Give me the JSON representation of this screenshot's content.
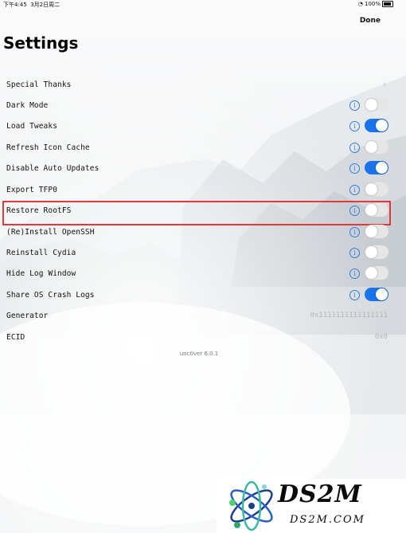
{
  "status_bar": {
    "time": "下午4:45",
    "date": "3月2日周二",
    "battery": "100%"
  },
  "nav": {
    "done_label": "Done"
  },
  "page": {
    "title": "Settings"
  },
  "rows": {
    "special_thanks": {
      "label": "Special Thanks"
    },
    "dark_mode": {
      "label": "Dark Mode",
      "on": false
    },
    "load_tweaks": {
      "label": "Load Tweaks",
      "on": true
    },
    "refresh_icon_cache": {
      "label": "Refresh Icon Cache",
      "on": false
    },
    "disable_auto_updates": {
      "label": "Disable Auto Updates",
      "on": true
    },
    "export_tfp0": {
      "label": "Export TFP0",
      "on": false
    },
    "restore_rootfs": {
      "label": "Restore RootFS",
      "on": false
    },
    "reinstall_openssh": {
      "label": "(Re)Install OpenSSH",
      "on": false
    },
    "reinstall_cydia": {
      "label": "Reinstall Cydia",
      "on": false
    },
    "hide_log_window": {
      "label": "Hide Log Window",
      "on": false
    },
    "share_os_crash_logs": {
      "label": "Share OS Crash Logs",
      "on": true
    },
    "generator": {
      "label": "Generator",
      "value": "0x1111111111111111"
    },
    "ecid": {
      "label": "ECID",
      "value": "0x0"
    }
  },
  "info_glyph": "i",
  "chevron_glyph": "›",
  "version": "unc0ver 6.0.1",
  "watermark": {
    "brand": "DS2M",
    "url": "DS2M.COM"
  },
  "colors": {
    "accent": "#1a73e8",
    "highlight_border": "#e0393c",
    "info": "#2f7de1"
  }
}
